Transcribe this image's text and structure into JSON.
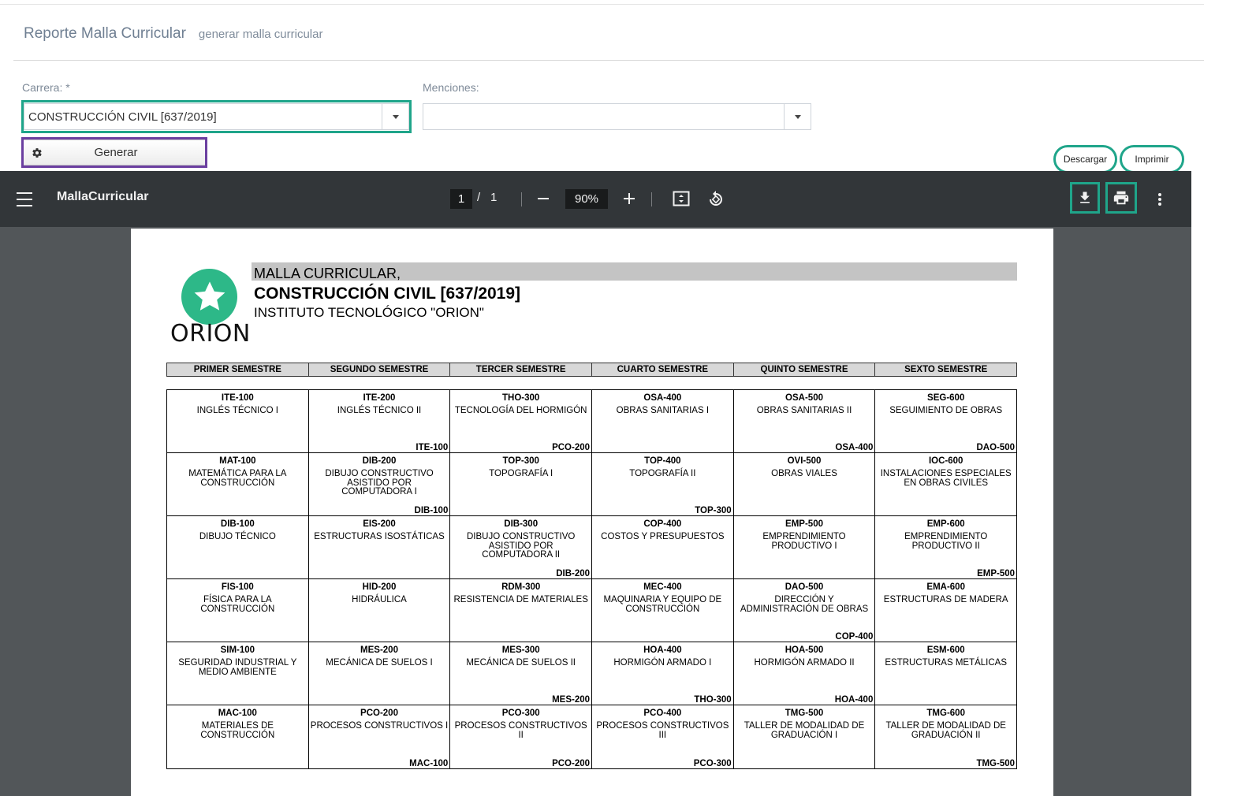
{
  "header": {
    "title": "Reporte Malla Curricular",
    "subtitle": "generar malla curricular"
  },
  "form": {
    "carrera_label": "Carrera:  *",
    "carrera_value": "CONSTRUCCIÓN CIVIL [637/2019]",
    "menciones_label": "Menciones:",
    "menciones_value": "",
    "generate_label": "Generar"
  },
  "callouts": {
    "download": "Descargar",
    "print": "Imprimir"
  },
  "viewer": {
    "doc_title": "MallaCurricular",
    "page_current": "1",
    "page_separator": "/",
    "page_total": "1",
    "zoom": "90%"
  },
  "document": {
    "title_line1": "MALLA CURRICULAR,",
    "title_line2": "CONSTRUCCIÓN CIVIL [637/2019]",
    "institute": "INSTITUTO TECNOLÓGICO  \"ORION\"",
    "logo_text": "ORION",
    "semesters": [
      "PRIMER SEMESTRE",
      "SEGUNDO SEMESTRE",
      "TERCER SEMESTRE",
      "CUARTO SEMESTRE",
      "QUINTO SEMESTRE",
      "SEXTO SEMESTRE"
    ],
    "rows": [
      [
        {
          "code": "ITE-100",
          "name": "INGLÉS TÉCNICO I",
          "prereq": ""
        },
        {
          "code": "ITE-200",
          "name": "INGLÉS TÉCNICO II",
          "prereq": "ITE-100"
        },
        {
          "code": "THO-300",
          "name": "TECNOLOGÍA DEL HORMIGÓN",
          "prereq": "PCO-200"
        },
        {
          "code": "OSA-400",
          "name": "OBRAS SANITARIAS I",
          "prereq": ""
        },
        {
          "code": "OSA-500",
          "name": "OBRAS SANITARIAS II",
          "prereq": "OSA-400"
        },
        {
          "code": "SEG-600",
          "name": "SEGUIMIENTO DE OBRAS",
          "prereq": "DAO-500"
        }
      ],
      [
        {
          "code": "MAT-100",
          "name": "MATEMÁTICA PARA LA CONSTRUCCIÓN",
          "prereq": ""
        },
        {
          "code": "DIB-200",
          "name": "DIBUJO CONSTRUCTIVO ASISTIDO POR COMPUTADORA I",
          "prereq": "DIB-100"
        },
        {
          "code": "TOP-300",
          "name": "TOPOGRAFÍA I",
          "prereq": ""
        },
        {
          "code": "TOP-400",
          "name": "TOPOGRAFÍA II",
          "prereq": "TOP-300"
        },
        {
          "code": "OVI-500",
          "name": "OBRAS VIALES",
          "prereq": ""
        },
        {
          "code": "IOC-600",
          "name": "INSTALACIONES ESPECIALES EN OBRAS CIVILES",
          "prereq": ""
        }
      ],
      [
        {
          "code": "DIB-100",
          "name": "DIBUJO TÉCNICO",
          "prereq": ""
        },
        {
          "code": "EIS-200",
          "name": "ESTRUCTURAS ISOSTÁTICAS",
          "prereq": ""
        },
        {
          "code": "DIB-300",
          "name": "DIBUJO CONSTRUCTIVO ASISTIDO POR COMPUTADORA II",
          "prereq": "DIB-200"
        },
        {
          "code": "COP-400",
          "name": "COSTOS Y PRESUPUESTOS",
          "prereq": ""
        },
        {
          "code": "EMP-500",
          "name": "EMPRENDIMIENTO PRODUCTIVO I",
          "prereq": ""
        },
        {
          "code": "EMP-600",
          "name": "EMPRENDIMIENTO PRODUCTIVO II",
          "prereq": "EMP-500"
        }
      ],
      [
        {
          "code": "FIS-100",
          "name": "FÍSICA PARA LA CONSTRUCCIÓN",
          "prereq": ""
        },
        {
          "code": "HID-200",
          "name": "HIDRÁULICA",
          "prereq": ""
        },
        {
          "code": "RDM-300",
          "name": "RESISTENCIA DE MATERIALES",
          "prereq": ""
        },
        {
          "code": "MEC-400",
          "name": "MAQUINARIA Y EQUIPO DE CONSTRUCCIÓN",
          "prereq": ""
        },
        {
          "code": "DAO-500",
          "name": "DIRECCIÓN Y ADMINISTRACIÓN DE OBRAS",
          "prereq": "COP-400"
        },
        {
          "code": "EMA-600",
          "name": "ESTRUCTURAS DE MADERA",
          "prereq": ""
        }
      ],
      [
        {
          "code": "SIM-100",
          "name": "SEGURIDAD INDUSTRIAL Y MEDIO AMBIENTE",
          "prereq": ""
        },
        {
          "code": "MES-200",
          "name": "MECÁNICA DE SUELOS I",
          "prereq": ""
        },
        {
          "code": "MES-300",
          "name": "MECÁNICA DE SUELOS II",
          "prereq": "MES-200"
        },
        {
          "code": "HOA-400",
          "name": "HORMIGÓN ARMADO I",
          "prereq": "THO-300"
        },
        {
          "code": "HOA-500",
          "name": "HORMIGÓN ARMADO II",
          "prereq": "HOA-400"
        },
        {
          "code": "ESM-600",
          "name": "ESTRUCTURAS METÁLICAS",
          "prereq": ""
        }
      ],
      [
        {
          "code": "MAC-100",
          "name": "MATERIALES DE CONSTRUCCIÓN",
          "prereq": ""
        },
        {
          "code": "PCO-200",
          "name": "PROCESOS CONSTRUCTIVOS I",
          "prereq": "MAC-100"
        },
        {
          "code": "PCO-300",
          "name": "PROCESOS CONSTRUCTIVOS II",
          "prereq": "PCO-200"
        },
        {
          "code": "PCO-400",
          "name": "PROCESOS CONSTRUCTIVOS III",
          "prereq": "PCO-300"
        },
        {
          "code": "TMG-500",
          "name": "TALLER DE MODALIDAD DE GRADUACIÓN I",
          "prereq": ""
        },
        {
          "code": "TMG-600",
          "name": "TALLER DE MODALIDAD DE GRADUACIÓN II",
          "prereq": "TMG-500"
        }
      ]
    ]
  },
  "icons": {
    "menu": "hamburger-icon",
    "gear": "gear-icon",
    "fit": "fit-page-icon",
    "rotate": "rotate-icon",
    "download": "download-icon",
    "print": "print-icon",
    "more": "more-vert-icon",
    "logo": "star-icon"
  },
  "colors": {
    "highlight_green": "#1fa58a",
    "highlight_purple": "#6b3fa0",
    "logo_green": "#2db888",
    "viewer_bar": "#323639",
    "viewer_bg": "#525659"
  }
}
